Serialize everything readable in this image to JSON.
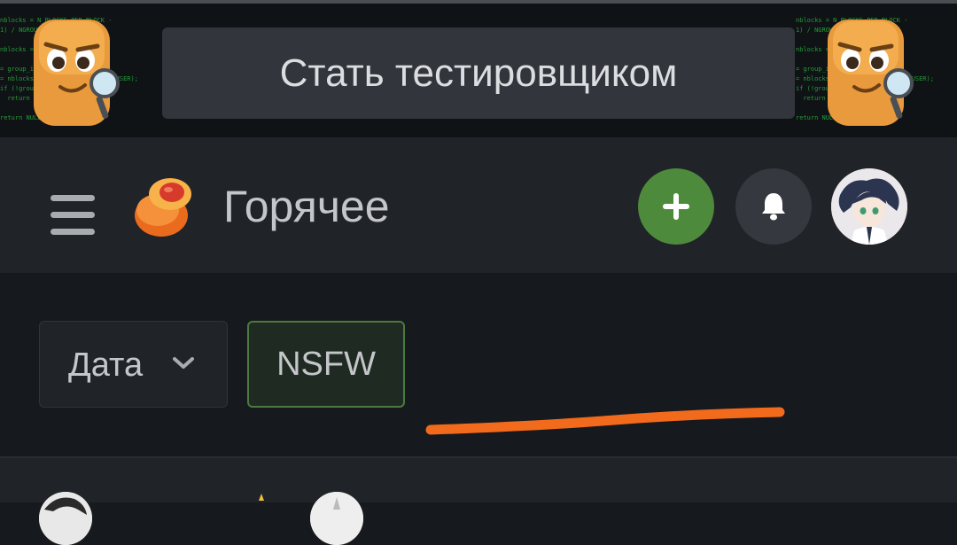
{
  "banner": {
    "cta_label": "Стать тестировщиком",
    "code_text": "nblocks = N_BLOCKS_PER_BLOCK -\n1) / NGROUPS;\n\nnblocks =\n\n= group_info\n= nblocks*sizeof(gid_t *), GFP_USER);\nif (!group_info)\n  return NULL;\n\nreturn NULL;"
  },
  "header": {
    "title": "Горячее",
    "add_color": "#4e8a3c"
  },
  "filters": {
    "date_label": "Дата",
    "nsfw_label": "NSFW"
  },
  "colors": {
    "accent_green": "#4e8a3c",
    "annotation": "#f26a1b",
    "background": "#16191d"
  }
}
